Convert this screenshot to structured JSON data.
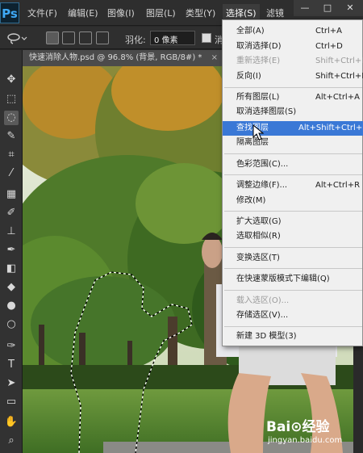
{
  "menubar": {
    "logo": "Ps",
    "items": [
      "文件(F)",
      "编辑(E)",
      "图像(I)",
      "图层(L)",
      "类型(Y)",
      "选择(S)",
      "滤镜"
    ],
    "window_controls": [
      "—",
      "□",
      "✕"
    ]
  },
  "options": {
    "feather_label": "羽化:",
    "feather_value": "0 像素",
    "antialias_label": "消"
  },
  "document": {
    "tab_title": "快速消除人物.psd @ 96.8% (背景, RGB/8#) *",
    "close": "×"
  },
  "select_menu": {
    "items": [
      {
        "label": "全部(A)",
        "shortcut": "Ctrl+A",
        "state": "normal"
      },
      {
        "label": "取消选择(D)",
        "shortcut": "Ctrl+D",
        "state": "normal"
      },
      {
        "label": "重新选择(E)",
        "shortcut": "Shift+Ctrl+D",
        "state": "disabled"
      },
      {
        "label": "反向(I)",
        "shortcut": "Shift+Ctrl+I",
        "state": "normal"
      },
      {
        "label": "所有图层(L)",
        "shortcut": "Alt+Ctrl+A",
        "state": "normal"
      },
      {
        "label": "取消选择图层(S)",
        "shortcut": "",
        "state": "normal"
      },
      {
        "label": "查找图层",
        "shortcut": "Alt+Shift+Ctrl+F",
        "state": "highlighted"
      },
      {
        "label": "隔离图层",
        "shortcut": "",
        "state": "normal"
      },
      {
        "label": "色彩范围(C)...",
        "shortcut": "",
        "state": "normal"
      },
      {
        "label": "调整边缘(F)...",
        "shortcut": "Alt+Ctrl+R",
        "state": "normal"
      },
      {
        "label": "修改(M)",
        "shortcut": "",
        "state": "normal"
      },
      {
        "label": "扩大选取(G)",
        "shortcut": "",
        "state": "normal"
      },
      {
        "label": "选取相似(R)",
        "shortcut": "",
        "state": "normal"
      },
      {
        "label": "变换选区(T)",
        "shortcut": "",
        "state": "normal"
      },
      {
        "label": "在快速蒙版模式下编辑(Q)",
        "shortcut": "",
        "state": "normal"
      },
      {
        "label": "载入选区(O)...",
        "shortcut": "",
        "state": "disabled"
      },
      {
        "label": "存储选区(V)...",
        "shortcut": "",
        "state": "normal"
      },
      {
        "label": "新建 3D 模型(3)",
        "shortcut": "",
        "state": "normal"
      }
    ]
  },
  "watermark": {
    "logo": "Bai⊙经验",
    "url": "jingyan.baidu.com"
  },
  "colors": {
    "highlight": "#3a78d6",
    "menu_bg": "#f0f0f0"
  }
}
